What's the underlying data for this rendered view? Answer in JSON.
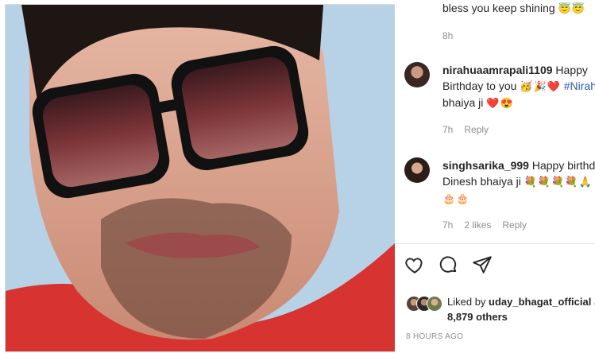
{
  "post_image": {
    "description_icon": "portrait-photo"
  },
  "comments": [
    {
      "text": "bless you keep shining",
      "emoji": "😇😇",
      "time": "8h"
    },
    {
      "username": "nirahuaamrapali1109",
      "text": "Happy Birthday to you",
      "emoji": "🥳🎉❤️",
      "hashtag": "#Nirah",
      "text2": "bhaiya ji",
      "emoji2": "❤️😍",
      "time": "7h",
      "reply_label": "Reply"
    },
    {
      "username": "singhsarika_999",
      "text": "Happy birthday Dinesh bhaiya ji",
      "emoji": "💐💐💐💐🙏",
      "emoji2": "🎂🎂🎂",
      "time": "7h",
      "likes": "2 likes",
      "reply_label": "Reply"
    }
  ],
  "actions": {
    "like_icon": "heart-icon",
    "comment_icon": "comment-icon",
    "share_icon": "send-icon"
  },
  "likes": {
    "prefix": "Liked by",
    "user": "uday_bhagat_official",
    "suffix": "a",
    "count": "8,879 others"
  },
  "timestamp": "8 HOURS AGO"
}
